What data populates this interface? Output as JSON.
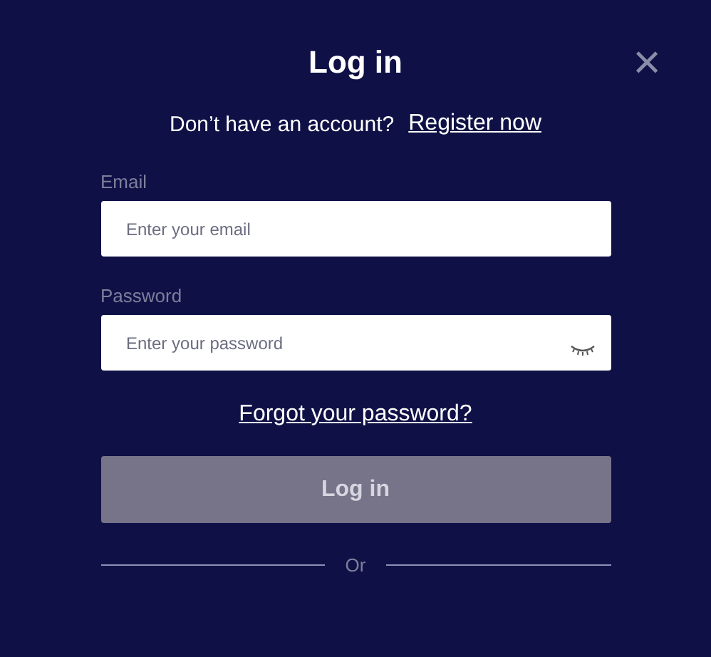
{
  "dialog": {
    "title": "Log in",
    "close": "×"
  },
  "register_prompt": {
    "text": "Don’t have an account?",
    "link": "Register now"
  },
  "fields": [
    {
      "label": "Email",
      "placeholder": "Enter your email",
      "kind": "text"
    },
    {
      "label": "Password",
      "placeholder": "Enter your password",
      "kind": "password"
    }
  ],
  "forgot_link": "Forgot your password?",
  "submit": {
    "label": "Log in",
    "disabled": true
  },
  "divider": "Or"
}
